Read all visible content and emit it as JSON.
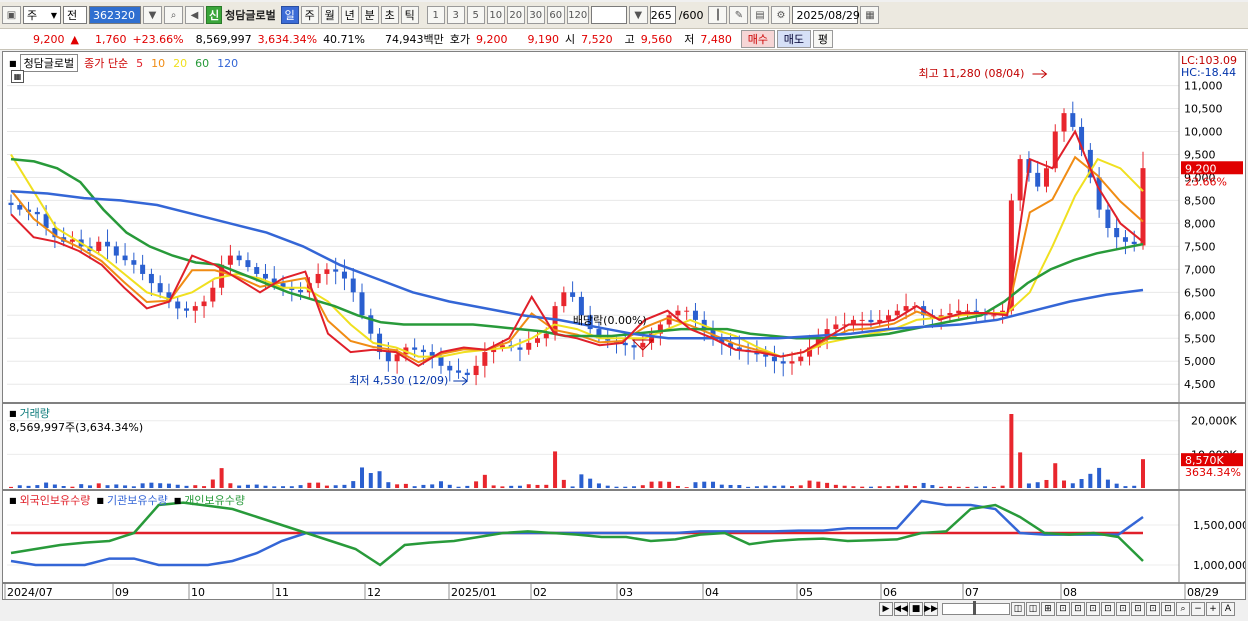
{
  "toolbar": {
    "market": "주",
    "mode": "전",
    "stock_code": "362320",
    "new_badge": "신",
    "stock_name": "청담글로벌",
    "periods": [
      "일",
      "주",
      "월",
      "년",
      "분",
      "초",
      "틱"
    ],
    "selected_period": "일",
    "intervals": [
      "1",
      "3",
      "5",
      "10",
      "20",
      "30",
      "60",
      "120"
    ],
    "count": "265",
    "count_max": "/600",
    "date": "2025/08/29"
  },
  "quote": {
    "price": "9,200",
    "arrow": "▲",
    "change": "1,760",
    "change_pct": "+23.66%",
    "volume": "8,569,997",
    "volume_pct": "3,634.34%",
    "turnover": "40.71%",
    "amount": "74,943백만",
    "ask_label": "호가",
    "ask1": "9,200",
    "ask2": "9,190",
    "open_label": "시",
    "open": "7,520",
    "high_label": "고",
    "high": "9,560",
    "low_label": "저",
    "low": "7,480",
    "buy_button": "매수",
    "sell_button": "매도",
    "eval_button": "평"
  },
  "price_panel": {
    "title": "청담글로벌",
    "ma_label": "종가 단순",
    "ma_periods": [
      "5",
      "10",
      "20",
      "60",
      "120"
    ],
    "lc": "LC:103.09",
    "hc": "HC:-18.44",
    "price_tag": "9,200",
    "price_pct_tag": "23.66%",
    "high_annotation": "최고 11,280 (08/04)",
    "low_annotation": "최저 4,530 (12/09)",
    "dividend_annotation": "배당락(0.00%)"
  },
  "volume_panel": {
    "title": "거래량",
    "summary": "8,569,997주(3,634.34%)",
    "tag_value": "8,570K",
    "tag_pct": "3634.34%"
  },
  "holding_panel": {
    "legend": [
      "외국인보유수량",
      "기관보유수량",
      "개인보유수량"
    ]
  },
  "colors": {
    "ma5": "#e0202a",
    "ma10": "#f08c14",
    "ma20": "#f0e020",
    "ma60": "#289a3a",
    "ma120": "#3466d6",
    "up": "#e8262d",
    "down": "#2a5fcf"
  },
  "chart_data": [
    {
      "type": "candlestick",
      "title": "청담글로벌",
      "y_axis_ticks": [
        4500,
        5000,
        5500,
        6000,
        6500,
        7000,
        7500,
        8000,
        8500,
        9000,
        9500,
        10000,
        10500,
        11000
      ],
      "ylim": [
        4200,
        11600
      ],
      "x_axis_labels": [
        "2024/07",
        "09",
        "10",
        "11",
        "12",
        "2025/01",
        "02",
        "03",
        "04",
        "05",
        "06",
        "07",
        "08",
        "08/29"
      ],
      "series": [
        {
          "name": "5",
          "approx_points": [
            8200,
            7700,
            7600,
            7400,
            7100,
            6600,
            6150,
            6300,
            7300,
            7100,
            6800,
            6500,
            6800,
            6950,
            5600,
            5200,
            5250,
            5200,
            4900,
            5200,
            5300,
            5250,
            5500,
            6400,
            5600,
            5500,
            5350,
            5400,
            5900,
            6100,
            5700,
            5500,
            5250,
            5200,
            5100,
            5200,
            5500,
            5800,
            5800,
            5900,
            6200,
            5900,
            6050,
            6050,
            6000,
            9400,
            9200,
            10000,
            8800,
            8000,
            7600
          ]
        },
        {
          "name": "20",
          "approx_points": [
            9500,
            8700,
            7900,
            7600,
            7300,
            6900,
            6500,
            6350,
            6500,
            6800,
            6900,
            6800,
            6600,
            6600,
            6300,
            5800,
            5400,
            5300,
            5100,
            5100,
            5200,
            5250,
            5300,
            5500,
            5800,
            5700,
            5500,
            5500,
            5500,
            5700,
            5900,
            5700,
            5550,
            5300,
            5100,
            5200,
            5400,
            5500,
            5600,
            5700,
            5900,
            5950,
            6000,
            6050,
            6050,
            6500,
            7500,
            8600,
            9400,
            9200,
            8700
          ]
        },
        {
          "name": "60",
          "approx_points": [
            9400,
            9350,
            9200,
            8900,
            8300,
            7800,
            7500,
            7300,
            7150,
            7100,
            6900,
            6700,
            6500,
            6350,
            6200,
            6000,
            5850,
            5800,
            5800,
            5800,
            5800,
            5750,
            5700,
            5650,
            5550,
            5550,
            5550,
            5600,
            5650,
            5700,
            5700,
            5700,
            5600,
            5550,
            5500,
            5500,
            5500,
            5550,
            5600,
            5700,
            5800,
            5900,
            6000,
            6300,
            6700,
            7000,
            7200,
            7350,
            7450,
            7550
          ]
        },
        {
          "name": "120",
          "approx_points": [
            8700,
            8650,
            8550,
            8500,
            8400,
            8200,
            8000,
            7800,
            7500,
            7100,
            6800,
            6500,
            6300,
            6150,
            6000,
            5900,
            5750,
            5600,
            5500,
            5500,
            5500,
            5500,
            5550,
            5600,
            5700,
            5750,
            5800,
            5900,
            6100,
            6300,
            6450,
            6550
          ]
        }
      ],
      "last": {
        "open": 7520,
        "high": 9560,
        "low": 7480,
        "close": 9200
      }
    },
    {
      "type": "bar",
      "title": "거래량",
      "y_axis_ticks": [
        "10,000K",
        "20,000K"
      ],
      "last_value": 8569997
    },
    {
      "type": "line",
      "y_axis_ticks": [
        "1,000,000",
        "1,500,000"
      ],
      "series": [
        {
          "name": "외국인보유수량"
        },
        {
          "name": "기관보유수량"
        },
        {
          "name": "개인보유수량"
        }
      ]
    }
  ]
}
